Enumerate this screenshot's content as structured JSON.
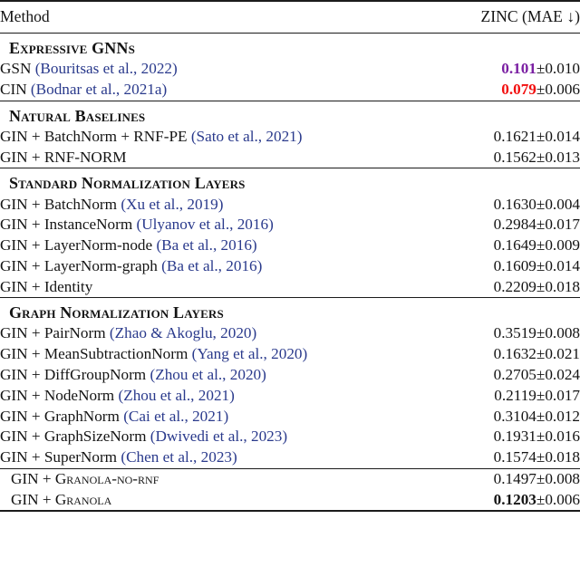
{
  "table": {
    "columns": {
      "method_header": "Method",
      "value_header": "ZINC (MAE ↓)"
    },
    "colors": {
      "citation": "#2a3a8c",
      "best_value": "#f20d0d",
      "second_best_value": "#7a1fa2",
      "rule": "#1b1b1b",
      "text": "#141414"
    },
    "sections": [
      {
        "title": "Expressive GNNs",
        "rows": [
          {
            "method_prefix": "GSN ",
            "citation": "(Bouritsas et al., 2022)",
            "value": "0.101",
            "pm": "±",
            "error": "0.010",
            "value_style": "purple"
          },
          {
            "method_prefix": "CIN ",
            "citation": "(Bodnar et al., 2021a)",
            "value": "0.079",
            "pm": "±",
            "error": "0.006",
            "value_style": "red"
          }
        ]
      },
      {
        "title": "Natural Baselines",
        "rows": [
          {
            "method_prefix": "GIN + BatchNorm + RNF-PE ",
            "citation": "(Sato et al., 2021)",
            "value": "0.1621",
            "pm": "±",
            "error": "0.014",
            "value_style": "plain"
          },
          {
            "method_prefix": "GIN + RNF-NORM",
            "citation": "",
            "value": "0.1562",
            "pm": "±",
            "error": "0.013",
            "value_style": "plain"
          }
        ]
      },
      {
        "title": "Standard Normalization Layers",
        "rows": [
          {
            "method_prefix": "GIN + BatchNorm ",
            "citation": "(Xu et al., 2019)",
            "value": "0.1630",
            "pm": "±",
            "error": "0.004",
            "value_style": "plain"
          },
          {
            "method_prefix": "GIN + InstanceNorm ",
            "citation": "(Ulyanov et al., 2016)",
            "value": "0.2984",
            "pm": "±",
            "error": "0.017",
            "value_style": "plain"
          },
          {
            "method_prefix": "GIN + LayerNorm-node ",
            "citation": "(Ba et al., 2016)",
            "value": "0.1649",
            "pm": "±",
            "error": "0.009",
            "value_style": "plain"
          },
          {
            "method_prefix": "GIN + LayerNorm-graph ",
            "citation": "(Ba et al., 2016)",
            "value": "0.1609",
            "pm": "±",
            "error": "0.014",
            "value_style": "plain"
          },
          {
            "method_prefix": "GIN + Identity",
            "citation": "",
            "value": "0.2209",
            "pm": "±",
            "error": "0.018",
            "value_style": "plain"
          }
        ]
      },
      {
        "title": "Graph Normalization Layers",
        "rows": [
          {
            "method_prefix": "GIN + PairNorm ",
            "citation": "(Zhao & Akoglu, 2020)",
            "value": "0.3519",
            "pm": "±",
            "error": "0.008",
            "value_style": "plain"
          },
          {
            "method_prefix": "GIN + MeanSubtractionNorm ",
            "citation": "(Yang et al., 2020)",
            "value": "0.1632",
            "pm": "±",
            "error": "0.021",
            "value_style": "plain"
          },
          {
            "method_prefix": "GIN + DiffGroupNorm ",
            "citation": "(Zhou et al., 2020)",
            "value": "0.2705",
            "pm": "±",
            "error": "0.024",
            "value_style": "plain"
          },
          {
            "method_prefix": "GIN + NodeNorm ",
            "citation": "(Zhou et al., 2021)",
            "value": "0.2119",
            "pm": "±",
            "error": "0.017",
            "value_style": "plain"
          },
          {
            "method_prefix": "GIN + GraphNorm ",
            "citation": "(Cai et al., 2021)",
            "value": "0.3104",
            "pm": "±",
            "error": "0.012",
            "value_style": "plain"
          },
          {
            "method_prefix": "GIN + GraphSizeNorm ",
            "citation": "(Dwivedi et al., 2023)",
            "value": "0.1931",
            "pm": "±",
            "error": "0.016",
            "value_style": "plain"
          },
          {
            "method_prefix": "GIN + SuperNorm ",
            "citation": "(Chen et al., 2023)",
            "value": "0.1574",
            "pm": "±",
            "error": "0.018",
            "value_style": "plain"
          }
        ]
      },
      {
        "title": "",
        "rows": [
          {
            "method_prefix": "GIN + ",
            "method_smallcaps": "Granola-no-rnf",
            "citation": "",
            "value": "0.1497",
            "pm": "±",
            "error": "0.008",
            "value_style": "plain"
          },
          {
            "method_prefix": "GIN + ",
            "method_smallcaps": "Granola",
            "citation": "",
            "value": "0.1203",
            "pm": "±",
            "error": "0.006",
            "value_style": "bold"
          }
        ]
      }
    ]
  }
}
